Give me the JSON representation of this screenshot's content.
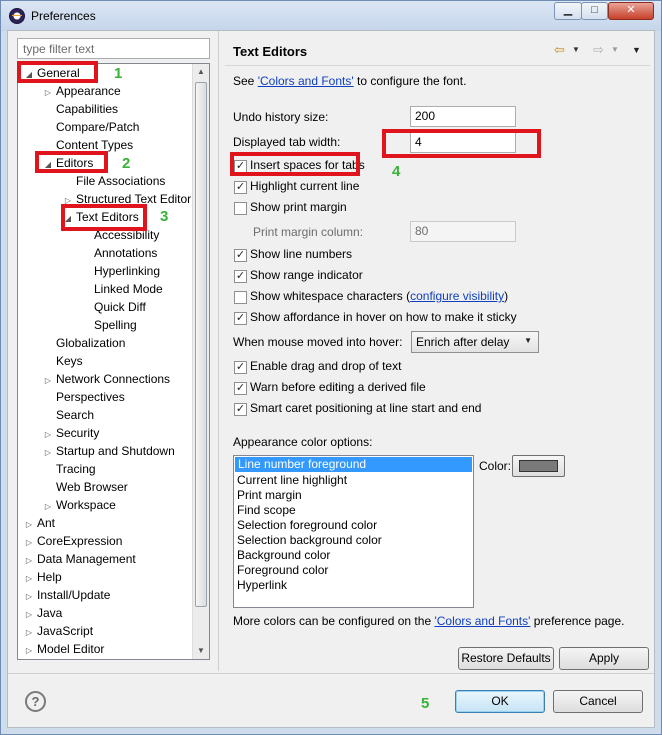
{
  "window": {
    "title": "Preferences"
  },
  "filter": {
    "placeholder": "type filter text"
  },
  "tree": [
    {
      "label": "General",
      "level": 0,
      "arrow": "open"
    },
    {
      "label": "Appearance",
      "level": 1,
      "arrow": "closed"
    },
    {
      "label": "Capabilities",
      "level": 1,
      "arrow": "none"
    },
    {
      "label": "Compare/Patch",
      "level": 1,
      "arrow": "none"
    },
    {
      "label": "Content Types",
      "level": 1,
      "arrow": "none"
    },
    {
      "label": "Editors",
      "level": 1,
      "arrow": "open"
    },
    {
      "label": "File Associations",
      "level": 2,
      "arrow": "none"
    },
    {
      "label": "Structured Text Editor",
      "level": 2,
      "arrow": "closed"
    },
    {
      "label": "Text Editors",
      "level": 2,
      "arrow": "open"
    },
    {
      "label": "Accessibility",
      "level": 3,
      "arrow": "none"
    },
    {
      "label": "Annotations",
      "level": 3,
      "arrow": "none"
    },
    {
      "label": "Hyperlinking",
      "level": 3,
      "arrow": "none"
    },
    {
      "label": "Linked Mode",
      "level": 3,
      "arrow": "none"
    },
    {
      "label": "Quick Diff",
      "level": 3,
      "arrow": "none"
    },
    {
      "label": "Spelling",
      "level": 3,
      "arrow": "none"
    },
    {
      "label": "Globalization",
      "level": 1,
      "arrow": "none"
    },
    {
      "label": "Keys",
      "level": 1,
      "arrow": "none"
    },
    {
      "label": "Network Connections",
      "level": 1,
      "arrow": "closed"
    },
    {
      "label": "Perspectives",
      "level": 1,
      "arrow": "none"
    },
    {
      "label": "Search",
      "level": 1,
      "arrow": "none"
    },
    {
      "label": "Security",
      "level": 1,
      "arrow": "closed"
    },
    {
      "label": "Startup and Shutdown",
      "level": 1,
      "arrow": "closed"
    },
    {
      "label": "Tracing",
      "level": 1,
      "arrow": "none"
    },
    {
      "label": "Web Browser",
      "level": 1,
      "arrow": "none"
    },
    {
      "label": "Workspace",
      "level": 1,
      "arrow": "closed"
    },
    {
      "label": "Ant",
      "level": 0,
      "arrow": "closed"
    },
    {
      "label": "CoreExpression",
      "level": 0,
      "arrow": "closed"
    },
    {
      "label": "Data Management",
      "level": 0,
      "arrow": "closed"
    },
    {
      "label": "Help",
      "level": 0,
      "arrow": "closed"
    },
    {
      "label": "Install/Update",
      "level": 0,
      "arrow": "closed"
    },
    {
      "label": "Java",
      "level": 0,
      "arrow": "closed"
    },
    {
      "label": "JavaScript",
      "level": 0,
      "arrow": "closed"
    },
    {
      "label": "Model Editor",
      "level": 0,
      "arrow": "closed"
    }
  ],
  "page": {
    "title": "Text Editors",
    "see_prefix": "See ",
    "see_link": "'Colors and Fonts'",
    "see_suffix": " to configure the font.",
    "undo_label": "Undo history size:",
    "undo_value": "200",
    "tab_width_label": "Displayed tab width:",
    "tab_width_value": "4",
    "checks": [
      {
        "label": "Insert spaces for tabs",
        "checked": true
      },
      {
        "label": "Highlight current line",
        "checked": true
      },
      {
        "label": "Show print margin",
        "checked": false
      }
    ],
    "print_margin_label": "Print margin column:",
    "print_margin_value": "80",
    "checks2": [
      {
        "label": "Show line numbers",
        "checked": true
      },
      {
        "label": "Show range indicator",
        "checked": true
      },
      {
        "label": "Show whitespace characters",
        "checked": false
      },
      {
        "label": "Show affordance in hover on how to make it sticky",
        "checked": true
      }
    ],
    "whitespace_link": "configure visibility",
    "hover_label": "When mouse moved into hover:",
    "hover_value": "Enrich after delay",
    "checks3": [
      {
        "label": "Enable drag and drop of text",
        "checked": true
      },
      {
        "label": "Warn before editing a derived file",
        "checked": true
      },
      {
        "label": "Smart caret positioning at line start and end",
        "checked": true
      }
    ],
    "color_options_label": "Appearance color options:",
    "color_options": [
      "Line number foreground",
      "Current line highlight",
      "Print margin",
      "Find scope",
      "Selection foreground color",
      "Selection background color",
      "Background color",
      "Foreground color",
      "Hyperlink"
    ],
    "color_label": "Color:",
    "color_value": "#7a7a7a",
    "more_prefix": "More colors can be configured on the ",
    "more_link": "'Colors and Fonts'",
    "more_suffix": " preference page.",
    "restore_defaults": "Restore Defaults",
    "apply": "Apply"
  },
  "footer": {
    "help": "?",
    "ok": "OK",
    "cancel": "Cancel"
  },
  "annotations": [
    "1",
    "2",
    "3",
    "4",
    "5"
  ]
}
